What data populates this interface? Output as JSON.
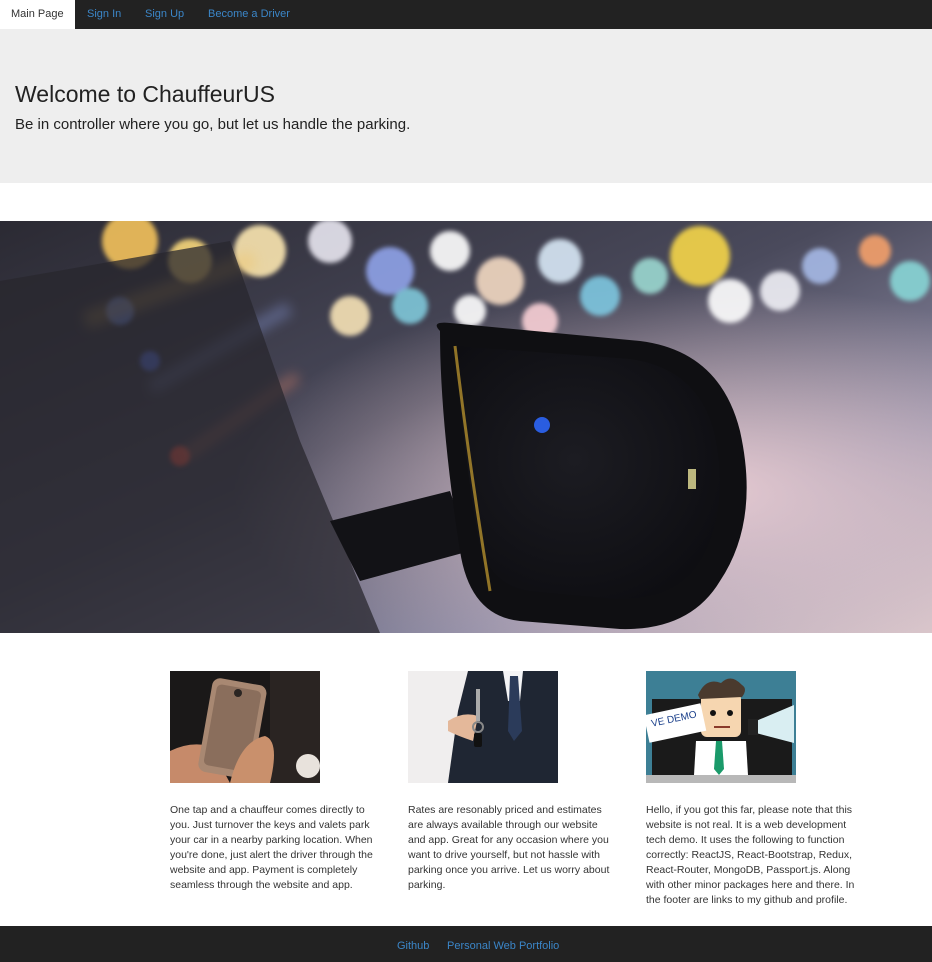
{
  "nav": {
    "main_page": "Main Page",
    "sign_in": "Sign In",
    "sign_up": "Sign Up",
    "become_driver": "Become a Driver"
  },
  "jumbotron": {
    "title": "Welcome to ChauffeurUS",
    "subtitle": "Be in controller where you go, but let us handle the parking."
  },
  "features": [
    {
      "text": "One tap and a chauffeur comes directly to you. Just turnover the keys and valets park your car in a nearby parking location. When you're done, just alert the driver through the website and app. Payment is completely seamless through the website and app."
    },
    {
      "text": "Rates are resonably priced and estimates are always available through our website and app. Great for any occasion where you want to drive yourself, but not hassle with parking once you arrive. Let us worry about parking."
    },
    {
      "text": "Hello, if you got this far, please note that this website is not real. It is a web development tech demo. It uses the following to function correctly: ReactJS, React-Bootstrap, Redux, React-Router, MongoDB, Passport.js. Along with other minor packages here and there. In the footer are links to my github and profile."
    }
  ],
  "demo_sign": "VE DEMO",
  "footer": {
    "github": "Github",
    "portfolio": "Personal Web Portfolio"
  },
  "colors": {
    "navbar": "#222222",
    "link": "#3b86c8",
    "jumbotron": "#eeeeee"
  }
}
